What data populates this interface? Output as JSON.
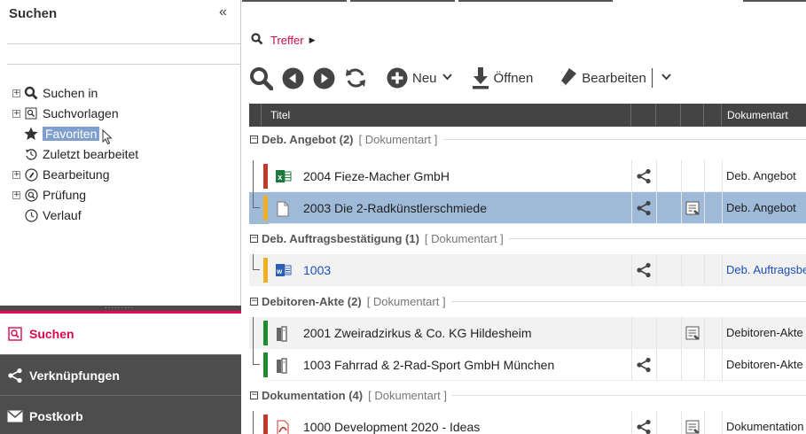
{
  "left": {
    "title": "Suchen",
    "collapse_label": "«",
    "search_placeholder": "",
    "tree": [
      {
        "label": "Suchen in",
        "icon": "search-icon",
        "expandable": true
      },
      {
        "label": "Suchvorlagen",
        "icon": "search-template-icon",
        "expandable": true
      },
      {
        "label": "Favoriten",
        "icon": "star-icon",
        "expandable": false,
        "selected": true
      },
      {
        "label": "Zuletzt bearbeitet",
        "icon": "history-icon",
        "expandable": false
      },
      {
        "label": "Bearbeitung",
        "icon": "edit-circle-icon",
        "expandable": true
      },
      {
        "label": "Prüfung",
        "icon": "review-icon",
        "expandable": true
      },
      {
        "label": "Verlauf",
        "icon": "clock-icon",
        "expandable": false
      }
    ],
    "tabs": [
      {
        "label": "Suchen",
        "icon": "search-doc-icon"
      },
      {
        "label": "Verknüpfungen",
        "icon": "share-icon"
      },
      {
        "label": "Postkorb",
        "icon": "mail-icon"
      }
    ]
  },
  "breadcrumb": {
    "label": "Treffer"
  },
  "toolbar": {
    "new_label": "Neu",
    "open_label": "Öffnen",
    "edit_label": "Bearbeiten"
  },
  "grid": {
    "columns": [
      "Titel",
      "",
      "",
      "",
      "Dokumentart"
    ],
    "groups": [
      {
        "name": "Deb. Angebot (2)",
        "type": "[ Dokumentart ]"
      },
      {
        "name": "Deb. Auftragsbestätigung (1)",
        "type": "[ Dokumentart ]"
      },
      {
        "name": "Debitoren-Akte (2)",
        "type": "[ Dokumentart ]"
      },
      {
        "name": "Dokumentation (4)",
        "type": "[ Dokumentart ]"
      }
    ],
    "rows": [
      {
        "title": "2004  Fieze-Macher GmbH",
        "doctype": "Deb. Angebot",
        "bar": "#c0392b",
        "icon": "excel-icon",
        "share": true,
        "note": false
      },
      {
        "title": "2003  Die 2-Radkünstlerschmiede",
        "doctype": "Deb. Angebot",
        "bar": "#f0b020",
        "icon": "document-icon",
        "share": true,
        "note": true
      },
      {
        "title": "1003",
        "doctype": "Deb. Auftragsbestätigung",
        "bar": "#f0b020",
        "icon": "word-icon",
        "share": true,
        "note": false
      },
      {
        "title": "2001  Zweiradzirkus & Co. KG  Hildesheim",
        "doctype": "Debitoren-Akte",
        "bar": "#1e8a2e",
        "icon": "folder-icon",
        "share": false,
        "note": true
      },
      {
        "title": "1003  Fahrrad & 2-Rad-Sport GmbH  München",
        "doctype": "Debitoren-Akte",
        "bar": "#1e8a2e",
        "icon": "folder-icon",
        "share": true,
        "note": false
      },
      {
        "title": "1000  Development 2020 - Ideas",
        "doctype": "Dokumentation",
        "bar": "#c0392b",
        "icon": "pdf-icon",
        "share": true,
        "note": true
      }
    ]
  },
  "colors": {
    "accent": "#e8095f",
    "selection": "#9fb9d8",
    "header_bg": "#444444"
  }
}
